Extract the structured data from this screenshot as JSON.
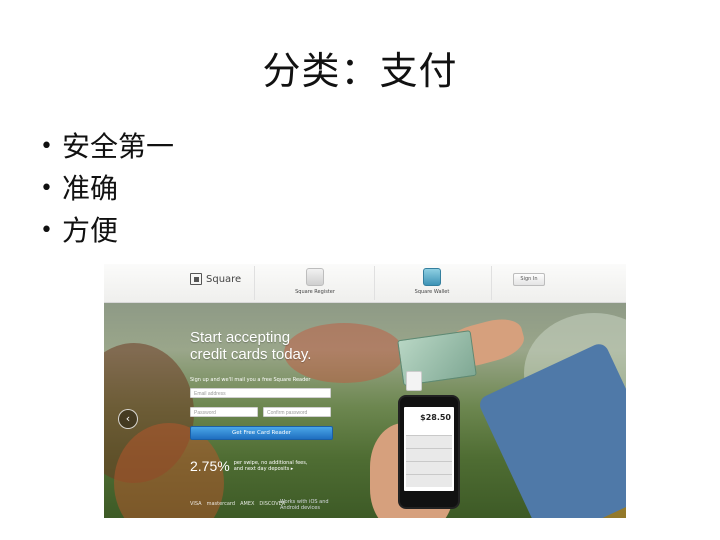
{
  "slide": {
    "title": "分类：支付",
    "bullets": [
      "安全第一",
      "准确",
      "方便"
    ]
  },
  "screenshot": {
    "nav": {
      "logo_text": "Square",
      "items": [
        {
          "label": "Square Register",
          "icon": "register-icon"
        },
        {
          "label": "Square Wallet",
          "icon": "wallet-icon"
        }
      ],
      "signin_label": "Sign In"
    },
    "hero": {
      "headline_line1": "Start accepting",
      "headline_line2": "credit cards today.",
      "signup_note": "Sign up and we'll mail you a free Square Reader",
      "email_placeholder": "Email address",
      "password_placeholder": "Password",
      "confirm_placeholder": "Confirm password",
      "cta_label": "Get Free Card Reader",
      "rate": "2.75%",
      "rate_desc": "per swipe, no additional fees, and next day deposits",
      "rate_desc_arrow": "▸",
      "card_logos": [
        "VISA",
        "mastercard",
        "AMEX",
        "DISCOVER"
      ],
      "ios_note": "Works with iOS and Android devices",
      "phone_amount": "$28.50"
    },
    "colors": {
      "cta": "#2d86d6",
      "wallet_icon": "#3e93b6",
      "sleeve": "#4f79a8"
    }
  }
}
